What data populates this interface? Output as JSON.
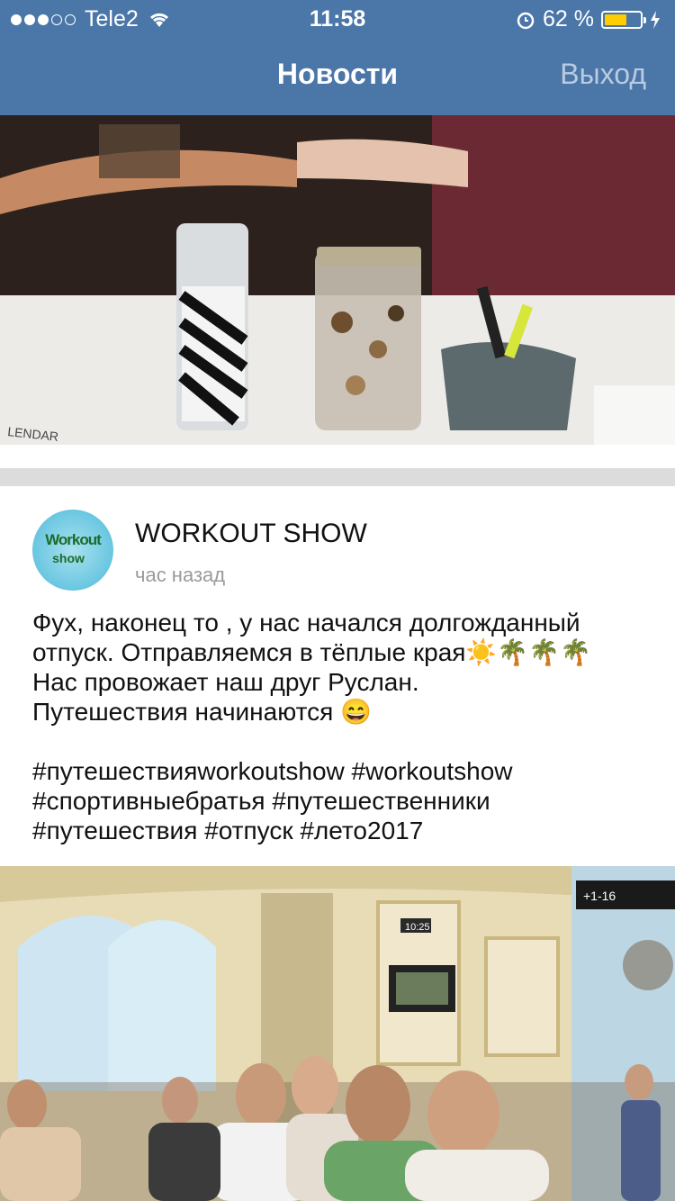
{
  "status_bar": {
    "carrier": "Tele2",
    "time": "11:58",
    "battery_percent": "62 %",
    "battery_level": 0.62
  },
  "nav": {
    "title": "Новости",
    "logout_label": "Выход"
  },
  "post": {
    "author": "WORKOUT SHOW",
    "time_ago": "час назад",
    "avatar_text_top": "Workout",
    "avatar_text_bottom": "show",
    "text_lines": [
      "Фух, наконец то , у нас начался долгожданный",
      "отпуск. Отправляемся в тёплые края☀️🌴🌴🌴",
      "Нас провожает наш друг Руслан.",
      "Путешествия начинаются 😄"
    ],
    "hashtag_lines": [
      "#путешествияworkoutshow #workoutshow",
      "#спортивныебратья #путешественники",
      "#путешествия #отпуск #лето2017"
    ]
  },
  "photo1": {
    "label": "LENDAR"
  },
  "photo2": {
    "clock": "10:25",
    "board": "+1-16"
  },
  "colors": {
    "header": "#4a76a8",
    "battery": "#ffcc00"
  }
}
